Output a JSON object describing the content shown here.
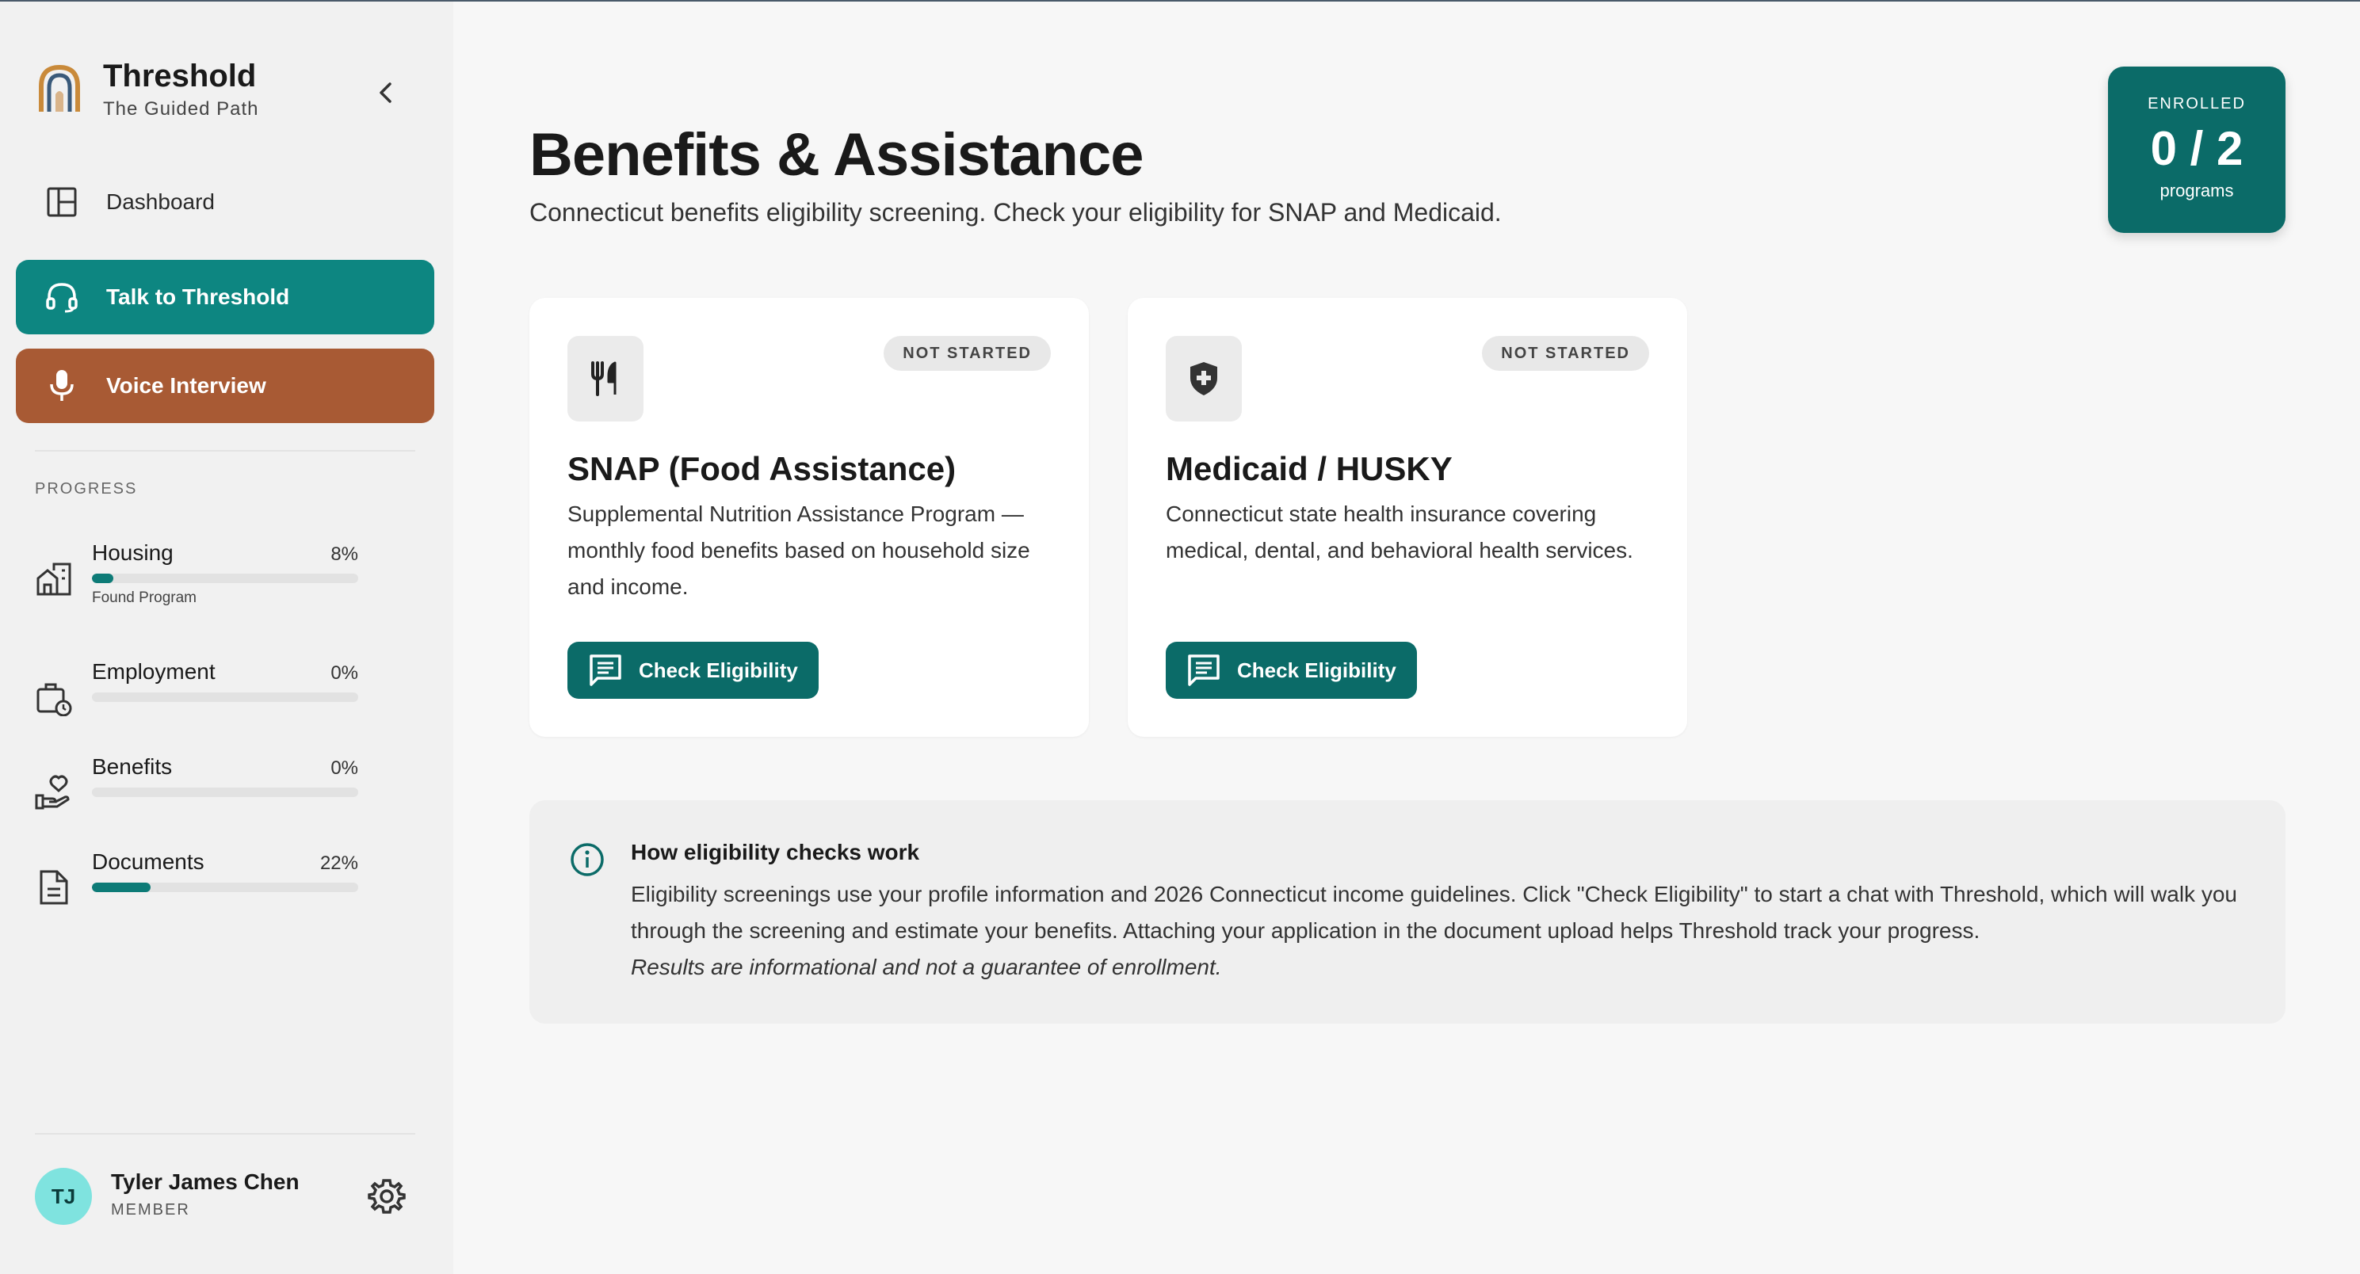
{
  "brand": {
    "title": "Threshold",
    "subtitle": "The Guided Path"
  },
  "nav": {
    "dashboard": "Dashboard",
    "talk": "Talk to Threshold",
    "voice": "Voice Interview"
  },
  "progress": {
    "heading": "PROGRESS",
    "items": [
      {
        "label": "Housing",
        "value_text": "8%",
        "percent": 8,
        "sub": "Found Program"
      },
      {
        "label": "Employment",
        "value_text": "0%",
        "percent": 0,
        "sub": ""
      },
      {
        "label": "Benefits",
        "value_text": "0%",
        "percent": 0,
        "sub": ""
      },
      {
        "label": "Documents",
        "value_text": "22%",
        "percent": 22,
        "sub": ""
      }
    ]
  },
  "user": {
    "initials": "TJ",
    "name": "Tyler James Chen",
    "role": "MEMBER"
  },
  "page": {
    "title": "Benefits & Assistance",
    "subtitle": "Connecticut benefits eligibility screening. Check your eligibility for SNAP and Medicaid."
  },
  "enrolled": {
    "label": "ENROLLED",
    "count": "0 / 2",
    "unit": "programs"
  },
  "programs": [
    {
      "icon": "utensils-icon",
      "status": "NOT STARTED",
      "title": "SNAP (Food Assistance)",
      "description": "Supplemental Nutrition Assistance Program — monthly food benefits based on household size and income.",
      "button": "Check Eligibility"
    },
    {
      "icon": "shield-plus-icon",
      "status": "NOT STARTED",
      "title": "Medicaid / HUSKY",
      "description": "Connecticut state health insurance covering medical, dental, and behavioral health services.",
      "button": "Check Eligibility"
    }
  ],
  "info": {
    "title": "How eligibility checks work",
    "body": "Eligibility screenings use your profile information and 2026 Connecticut income guidelines. Click \"Check Eligibility\" to start a chat with Threshold, which will walk you through the screening and estimate your benefits. Attaching your application in the document upload helps Threshold track your progress.",
    "note": "Results are informational and not a guarantee of enrollment."
  },
  "colors": {
    "primary": "#0d8681",
    "primary_dark": "#0b6b68",
    "voice": "#a85a34",
    "avatar": "#7fe3df"
  }
}
